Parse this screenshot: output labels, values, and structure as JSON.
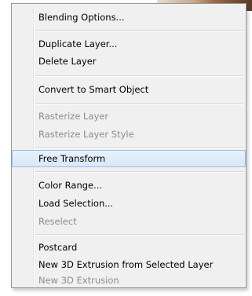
{
  "menu": {
    "items": [
      {
        "label": "Blending Options...",
        "enabled": true
      },
      {
        "label": "Duplicate Layer...",
        "enabled": true
      },
      {
        "label": "Delete Layer",
        "enabled": true
      },
      {
        "label": "Convert to Smart Object",
        "enabled": true
      },
      {
        "label": "Rasterize Layer",
        "enabled": false
      },
      {
        "label": "Rasterize Layer Style",
        "enabled": false
      },
      {
        "label": "Free Transform",
        "enabled": true,
        "highlighted": true
      },
      {
        "label": "Color Range...",
        "enabled": true
      },
      {
        "label": "Load Selection...",
        "enabled": true
      },
      {
        "label": "Reselect",
        "enabled": false
      },
      {
        "label": "Postcard",
        "enabled": true
      },
      {
        "label": "New 3D Extrusion from Selected Layer",
        "enabled": true
      },
      {
        "label": "New 3D Extrusion",
        "enabled": false
      }
    ]
  },
  "colors": {
    "highlight_border": "#99bde6",
    "disabled_text": "#8d8d8d",
    "menu_background": "#f0f0f0"
  }
}
